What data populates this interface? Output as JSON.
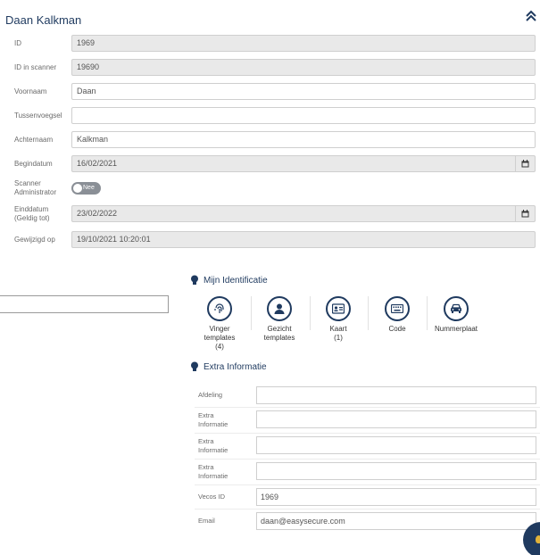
{
  "header": {
    "title": "Daan Kalkman"
  },
  "form": {
    "id_label": "ID",
    "id_value": "1969",
    "scanner_id_label": "ID in scanner",
    "scanner_id_value": "19690",
    "firstname_label": "Voornaam",
    "firstname_value": "Daan",
    "infix_label": "Tussenvoegsel",
    "infix_value": "",
    "lastname_label": "Achternaam",
    "lastname_value": "Kalkman",
    "startdate_label": "Begindatum",
    "startdate_value": "16/02/2021",
    "admin_label_line1": "Scanner",
    "admin_label_line2": "Administrator",
    "admin_toggle_text": "Nee",
    "enddate_label_line1": "Einddatum",
    "enddate_label_line2": "(Geldig tot)",
    "enddate_value": "23/02/2022",
    "modified_label": "Gewijzigd op",
    "modified_value": "19/10/2021 10:20:01"
  },
  "identification": {
    "title": "Mijn Identificatie",
    "items": [
      {
        "line1": "Vinger",
        "line2": "templates",
        "line3": "(4)",
        "icon": "fingerprint-icon"
      },
      {
        "line1": "Gezicht",
        "line2": "templates",
        "icon": "person-icon"
      },
      {
        "line1": "Kaart",
        "line2": "(1)",
        "icon": "id-card-icon"
      },
      {
        "line1": "Code",
        "icon": "keyboard-icon"
      },
      {
        "line1": "Nummerplaat",
        "icon": "car-icon"
      }
    ]
  },
  "extra": {
    "title": "Extra Informatie",
    "dept_label": "Afdeling",
    "dept_value": "",
    "extra1_line1": "Extra",
    "extra1_line2": "Informatie",
    "extra1_value": "",
    "extra2_line1": "Extra",
    "extra2_line2": "Informatie",
    "extra2_value": "",
    "extra3_line1": "Extra",
    "extra3_line2": "Informatie",
    "extra3_value": "",
    "vecos_label": "Vecos ID",
    "vecos_value": "1969",
    "email_label": "Email",
    "email_value": "daan@easysecure.com"
  },
  "colors": {
    "navy": "#1f3a5f",
    "readonly_bg": "#e9e9e9",
    "toggle_off": "#8a8f96"
  }
}
